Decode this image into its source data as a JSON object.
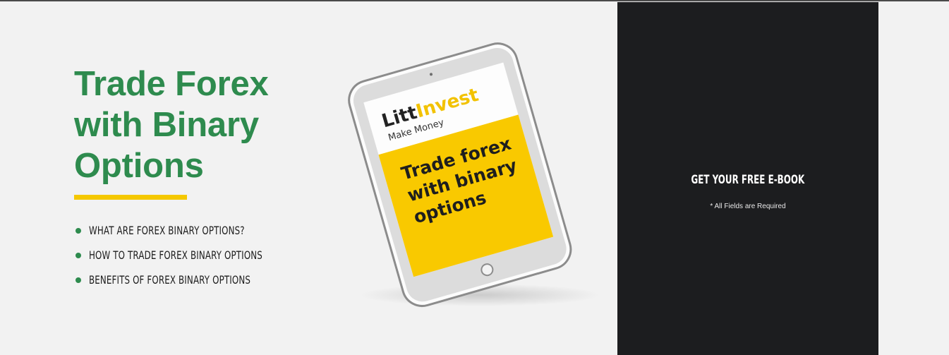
{
  "hero": {
    "title_lines": [
      "Trade Forex",
      "with Binary",
      "Options"
    ],
    "features": [
      "WHAT ARE FOREX BINARY OPTIONS?",
      "HOW TO TRADE FOREX BINARY OPTIONS",
      "BENEFITS OF FOREX BINARY OPTIONS"
    ]
  },
  "ebook": {
    "brand_part1": "Litt",
    "brand_part2": "Invest",
    "tagline": "Make Money",
    "cover_title_lines": [
      "Trade forex",
      "with binary",
      "options"
    ]
  },
  "form": {
    "heading": "GET YOUR FREE E-BOOK",
    "required_note": "* All Fields are Required"
  },
  "colors": {
    "brand_green": "#2e8b4e",
    "accent_yellow": "#f5c800",
    "panel_dark": "#1c1d1f",
    "background": "#f2f2f2"
  },
  "icons": {
    "bullet": "bullet-dot-icon",
    "tablet_home": "home-button-icon"
  }
}
